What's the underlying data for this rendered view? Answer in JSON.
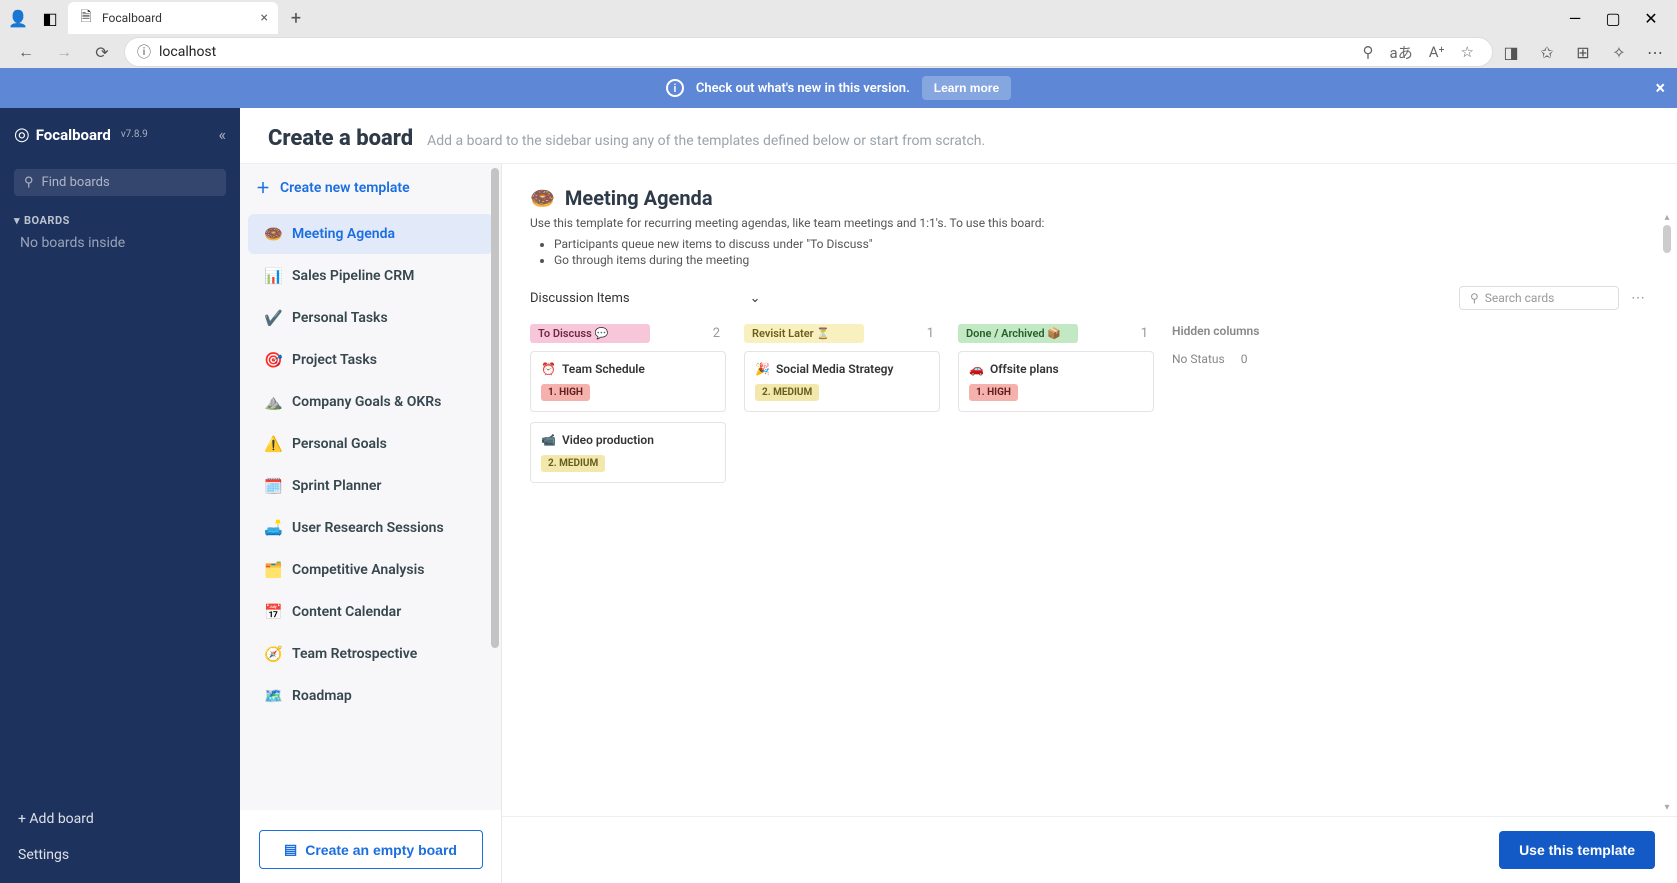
{
  "browser": {
    "tab_title": "Focalboard",
    "url": "localhost",
    "info_char": "ⓘ"
  },
  "banner": {
    "text": "Check out what's new in this version.",
    "learn_more": "Learn more"
  },
  "sidebar": {
    "brand": "Focalboard",
    "version": "v7.8.9",
    "find_placeholder": "Find boards",
    "section": "BOARDS",
    "empty": "No boards inside",
    "add_board": "+ Add board",
    "settings": "Settings"
  },
  "header": {
    "title": "Create a board",
    "subtitle": "Add a board to the sidebar using any of the templates defined below or start from scratch."
  },
  "templates": {
    "create_new": "Create new template",
    "items": [
      {
        "icon": "🍩",
        "label": "Meeting Agenda"
      },
      {
        "icon": "📊",
        "label": "Sales Pipeline CRM"
      },
      {
        "icon": "✔️",
        "label": "Personal Tasks"
      },
      {
        "icon": "🎯",
        "label": "Project Tasks"
      },
      {
        "icon": "⛰️",
        "label": "Company Goals & OKRs"
      },
      {
        "icon": "⚠️",
        "label": "Personal Goals"
      },
      {
        "icon": "🗓️",
        "label": "Sprint Planner"
      },
      {
        "icon": "🛋️",
        "label": "User Research Sessions"
      },
      {
        "icon": "🗂️",
        "label": "Competitive Analysis"
      },
      {
        "icon": "📅",
        "label": "Content Calendar"
      },
      {
        "icon": "🧭",
        "label": "Team Retrospective"
      },
      {
        "icon": "🗺️",
        "label": "Roadmap"
      }
    ],
    "empty_board_btn": "Create an empty board"
  },
  "preview": {
    "icon": "🍩",
    "title": "Meeting Agenda",
    "desc_intro": "Use this template for recurring meeting agendas, like team meetings and 1:1's. To use this board:",
    "desc_bullets": [
      "Participants queue new items to discuss under \"To Discuss\"",
      "Go through items during the meeting"
    ],
    "view_label": "Discussion Items",
    "search_placeholder": "Search cards",
    "hidden_columns": "Hidden columns",
    "no_status_label": "No Status",
    "no_status_count": "0",
    "columns": [
      {
        "label": "To Discuss 💬",
        "count": "2",
        "class": "lbl-todiscuss"
      },
      {
        "label": "Revisit Later ⏳",
        "count": "1",
        "class": "lbl-revisit"
      },
      {
        "label": "Done / Archived 📦",
        "count": "1",
        "class": "lbl-done"
      }
    ],
    "cards": {
      "col0": [
        {
          "icon": "⏰",
          "title": "Team Schedule",
          "badge": "1. HIGH",
          "badgecls": "badge-high"
        },
        {
          "icon": "📹",
          "title": "Video production",
          "badge": "2. MEDIUM",
          "badgecls": "badge-medium"
        }
      ],
      "col1": [
        {
          "icon": "🎉",
          "title": "Social Media Strategy",
          "badge": "2. MEDIUM",
          "badgecls": "badge-medium"
        }
      ],
      "col2": [
        {
          "icon": "🚗",
          "title": "Offsite plans",
          "badge": "1. HIGH",
          "badgecls": "badge-high"
        }
      ]
    },
    "use_template_btn": "Use this template"
  }
}
